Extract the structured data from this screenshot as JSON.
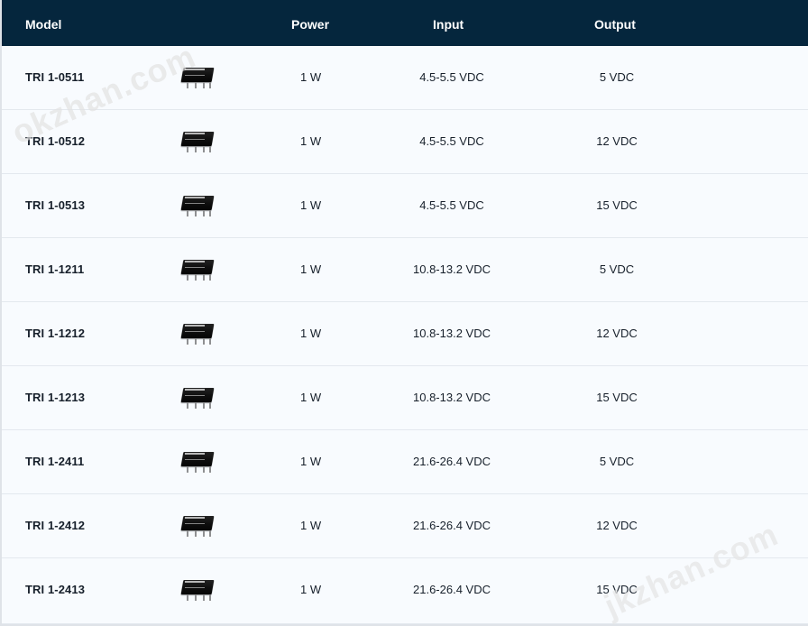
{
  "table": {
    "headers": [
      "Model",
      "",
      "Power",
      "Input",
      "Output"
    ],
    "rows": [
      {
        "model": "TRI 1-0511",
        "image_icon": "traco-power-converter-icon",
        "power": "1 W",
        "input": "4.5-5.5 VDC",
        "output": "5 VDC"
      },
      {
        "model": "TRI 1-0512",
        "image_icon": "traco-power-converter-icon",
        "power": "1 W",
        "input": "4.5-5.5 VDC",
        "output": "12 VDC"
      },
      {
        "model": "TRI 1-0513",
        "image_icon": "traco-power-converter-icon",
        "power": "1 W",
        "input": "4.5-5.5 VDC",
        "output": "15 VDC"
      },
      {
        "model": "TRI 1-1211",
        "image_icon": "traco-power-converter-icon",
        "power": "1 W",
        "input": "10.8-13.2 VDC",
        "output": "5 VDC"
      },
      {
        "model": "TRI 1-1212",
        "image_icon": "traco-power-converter-icon",
        "power": "1 W",
        "input": "10.8-13.2 VDC",
        "output": "12 VDC"
      },
      {
        "model": "TRI 1-1213",
        "image_icon": "traco-power-converter-icon",
        "power": "1 W",
        "input": "10.8-13.2 VDC",
        "output": "15 VDC"
      },
      {
        "model": "TRI 1-2411",
        "image_icon": "traco-power-converter-icon",
        "power": "1 W",
        "input": "21.6-26.4 VDC",
        "output": "5 VDC"
      },
      {
        "model": "TRI 1-2412",
        "image_icon": "traco-power-converter-icon",
        "power": "1 W",
        "input": "21.6-26.4 VDC",
        "output": "12 VDC"
      },
      {
        "model": "TRI 1-2413",
        "image_icon": "traco-power-converter-icon",
        "power": "1 W",
        "input": "21.6-26.4 VDC",
        "output": "15 VDC"
      }
    ]
  },
  "watermarks": {
    "top": "okzhan.com",
    "bottom": "jkzhan.com"
  },
  "colors": {
    "header_bg": "#05263d",
    "row_bg": "#f8fbfe",
    "row_divider": "#e3e8ee",
    "text": "#17202b"
  }
}
